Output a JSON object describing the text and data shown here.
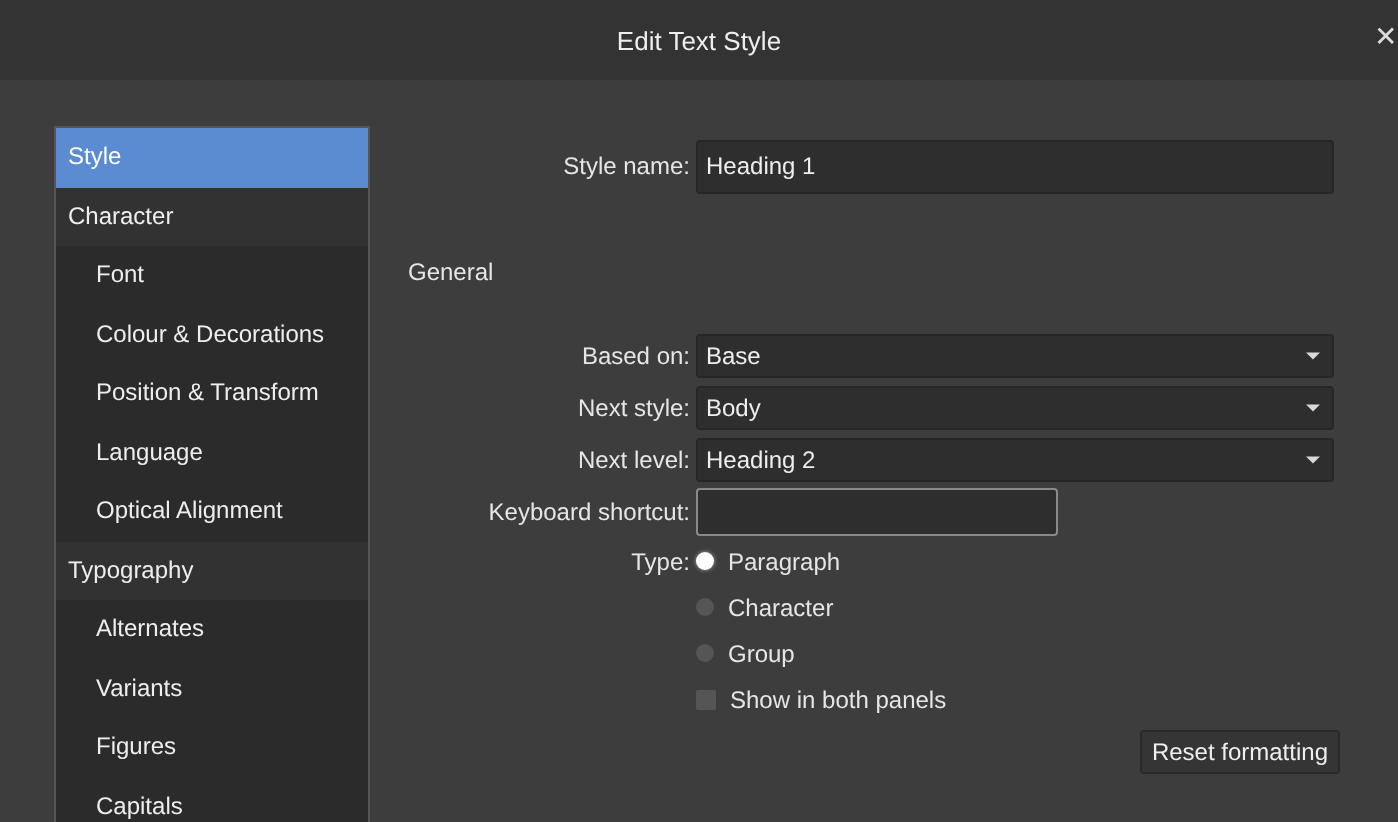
{
  "window": {
    "title": "Edit Text Style",
    "close": "✕"
  },
  "sidebar": {
    "items": [
      {
        "label": "Style",
        "selected": true
      },
      {
        "label": "Character",
        "selected": false,
        "children": [
          {
            "label": "Font",
            "selected": false
          },
          {
            "label": "Colour & Decorations",
            "selected": false
          },
          {
            "label": "Position & Transform",
            "selected": false
          },
          {
            "label": "Language",
            "selected": false
          },
          {
            "label": "Optical Alignment",
            "selected": false
          }
        ]
      },
      {
        "label": "Typography",
        "selected": false,
        "children": [
          {
            "label": "Alternates",
            "selected": false
          },
          {
            "label": "Variants",
            "selected": false
          },
          {
            "label": "Figures",
            "selected": false
          },
          {
            "label": "Capitals",
            "selected": false
          }
        ]
      }
    ]
  },
  "style_name": {
    "label": "Style name:",
    "value": "Heading 1"
  },
  "section": "General",
  "fields": [
    {
      "kind": "dropdown",
      "label": "Based on:",
      "value": "Base"
    },
    {
      "kind": "dropdown",
      "label": "Next style:",
      "value": "Body"
    },
    {
      "kind": "dropdown",
      "label": "Next level:",
      "value": "Heading 2"
    },
    {
      "kind": "shortcut",
      "label": "Keyboard shortcut:"
    }
  ],
  "type": {
    "label": "Type:",
    "options": [
      {
        "label": "Paragraph",
        "selected": true
      },
      {
        "label": "Character",
        "selected": false
      },
      {
        "label": "Group",
        "selected": false
      }
    ]
  },
  "show_both": {
    "label": "Show in both panels",
    "checked": false
  },
  "reset_button": "Reset formatting"
}
